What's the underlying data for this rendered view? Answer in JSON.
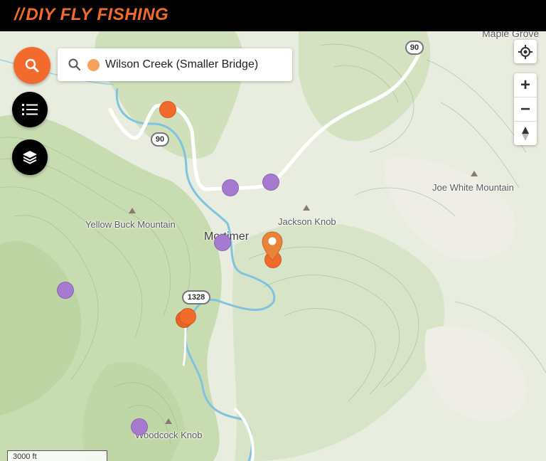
{
  "brand": {
    "slashes": "//",
    "name": "DIY FLY FISHING"
  },
  "colors": {
    "brand": "#f26a2c",
    "topbar": "#000000",
    "terrain": "#c9dcb4",
    "water": "#6fb9d6",
    "marker_orange": "#f36b2a",
    "marker_purple": "#a57ad0",
    "selected_dot": "#f7a25b"
  },
  "search": {
    "icon": "search-icon",
    "value": "Wilson Creek (Smaller Bridge)"
  },
  "buttons": {
    "search": "search-icon",
    "list": "list-icon",
    "layers": "layers-icon"
  },
  "controls": {
    "locate": "crosshair-icon",
    "zoom_in": "+",
    "zoom_out": "−",
    "compass": "compass-icon"
  },
  "map_labels": {
    "maple_grove": "Maple Grove",
    "joe_white": "Joe White Mountain",
    "jackson_knob": "Jackson Knob",
    "yellow_buck": "Yellow Buck Mountain",
    "mortimer": "Mortimer",
    "woodcock_knob": "Woodcock Knob"
  },
  "road_shields": {
    "r90_top": "90",
    "r90_left": "90",
    "r1328": "1328"
  },
  "scale": {
    "label": "3000 ft"
  }
}
